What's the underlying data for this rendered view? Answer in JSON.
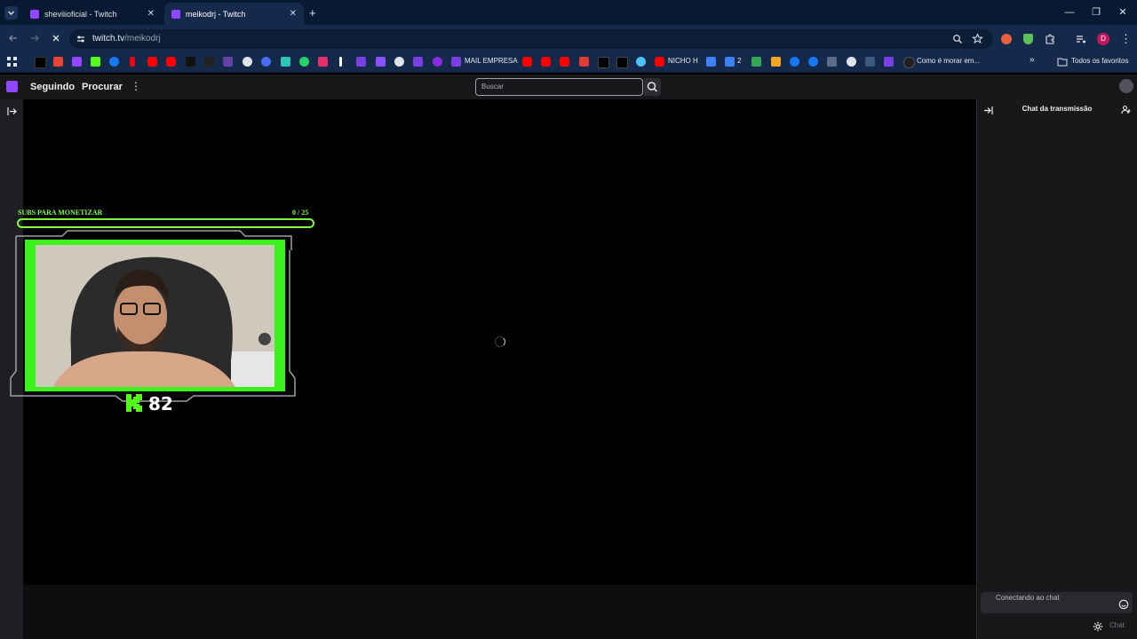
{
  "browser": {
    "tabs": [
      {
        "title": "sheviiioficial - Twitch",
        "active": false
      },
      {
        "title": "meikodrj - Twitch",
        "active": true
      }
    ],
    "new_tab_symbol": "+",
    "url_host": "twitch.tv",
    "url_path": "/meikodrj",
    "profile_initial": "D",
    "bookmarks_text": {
      "mail_empresa": "MAIL EMPRESA",
      "nicho_h": "NICHO H",
      "two": "2",
      "como_morar": "Como é morar em...",
      "todos_favoritos": "Todos os favoritos"
    }
  },
  "twitch": {
    "nav": {
      "following": "Seguindo",
      "browse": "Procurar"
    },
    "search_placeholder": "Buscar"
  },
  "overlay": {
    "subs_label": "SUBS PARA MONETIZAR",
    "subs_count": "0 / 25",
    "subs_progress": 0,
    "kick_count": "82"
  },
  "chat": {
    "title": "Chat da transmissão",
    "status": "Conectando ao chat",
    "send_label": "Chat"
  },
  "colors": {
    "overlay_green": "#3cf21c",
    "twitch_purple": "#9146ff",
    "chrome_bg": "#081a33"
  }
}
